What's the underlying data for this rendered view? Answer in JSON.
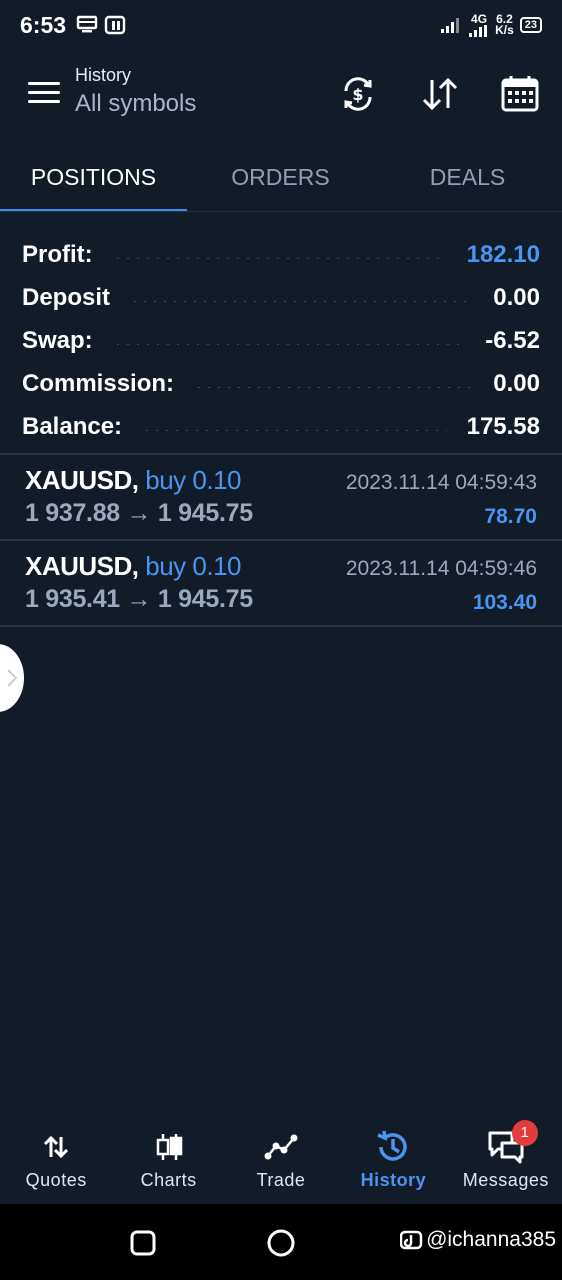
{
  "status_bar": {
    "time": "6:53",
    "network": "4G",
    "speed_value": "6.2",
    "speed_unit": "K/s",
    "battery": "23"
  },
  "header": {
    "title": "History",
    "subtitle": "All symbols"
  },
  "tabs": [
    {
      "label": "POSITIONS",
      "active": true
    },
    {
      "label": "ORDERS",
      "active": false
    },
    {
      "label": "DEALS",
      "active": false
    }
  ],
  "summary": [
    {
      "label": "Profit:",
      "value": "182.10",
      "highlight": true
    },
    {
      "label": "Deposit",
      "value": "0.00",
      "highlight": false
    },
    {
      "label": "Swap:",
      "value": "-6.52",
      "highlight": false
    },
    {
      "label": "Commission:",
      "value": "0.00",
      "highlight": false
    },
    {
      "label": "Balance:",
      "value": "175.58",
      "highlight": false
    }
  ],
  "positions": [
    {
      "symbol": "XAUUSD,",
      "side": "buy 0.10",
      "prices": "1 937.88 → 1 945.75",
      "datetime": "2023.11.14 04:59:43",
      "profit": "78.70"
    },
    {
      "symbol": "XAUUSD,",
      "side": "buy 0.10",
      "prices": "1 935.41 → 1 945.75",
      "datetime": "2023.11.14 04:59:46",
      "profit": "103.40"
    }
  ],
  "bottom_nav": [
    {
      "label": "Quotes",
      "icon": "quotes-arrows-icon",
      "active": false
    },
    {
      "label": "Charts",
      "icon": "candlestick-icon",
      "active": false
    },
    {
      "label": "Trade",
      "icon": "trend-line-icon",
      "active": false
    },
    {
      "label": "History",
      "icon": "history-clock-icon",
      "active": true
    },
    {
      "label": "Messages",
      "icon": "chat-bubbles-icon",
      "active": false,
      "badge": "1"
    }
  ],
  "watermark": "@ichanna385",
  "colors": {
    "background": "#121b28",
    "accent": "#4a95f0",
    "badge": "#e33c3c"
  }
}
